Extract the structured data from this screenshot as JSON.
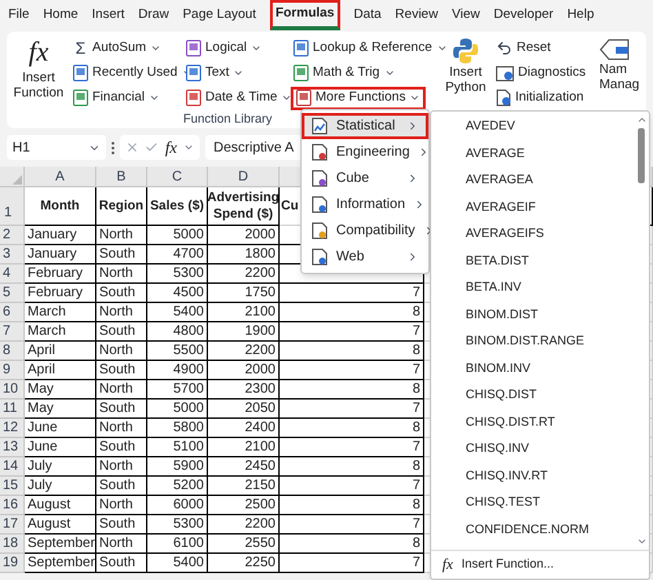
{
  "tabs": [
    {
      "label": "File",
      "selected": false
    },
    {
      "label": "Home",
      "selected": false
    },
    {
      "label": "Insert",
      "selected": false
    },
    {
      "label": "Draw",
      "selected": false
    },
    {
      "label": "Page Layout",
      "selected": false
    },
    {
      "label": "Formulas",
      "selected": true
    },
    {
      "label": "Data",
      "selected": false
    },
    {
      "label": "Review",
      "selected": false
    },
    {
      "label": "View",
      "selected": false
    },
    {
      "label": "Developer",
      "selected": false
    },
    {
      "label": "Help",
      "selected": false
    }
  ],
  "function_library": {
    "insert_function": {
      "icon": "fx",
      "label": "Insert Function"
    },
    "group_label": "Function Library",
    "buttons": [
      {
        "kind": "sum",
        "icon": "Σ",
        "label": "AutoSum",
        "open": false
      },
      {
        "kind": "book",
        "color": "#2f6fd1",
        "label": "Recently Used",
        "open": false
      },
      {
        "kind": "book",
        "color": "#2e9a4c",
        "label": "Financial",
        "open": false
      },
      {
        "kind": "book",
        "color": "#8a4fc7",
        "label": "Logical",
        "open": false
      },
      {
        "kind": "book",
        "color": "#2f6fd1",
        "label": "Text",
        "open": false
      },
      {
        "kind": "book",
        "color": "#d23a3a",
        "label": "Date & Time",
        "open": false
      },
      {
        "kind": "book",
        "color": "#2f6fd1",
        "label": "Lookup & Reference",
        "open": false
      },
      {
        "kind": "book",
        "color": "#2e9a4c",
        "label": "Math & Trig",
        "open": false
      },
      {
        "kind": "book",
        "color": "#c23a3a",
        "label": "More Functions",
        "open": true
      }
    ]
  },
  "python": {
    "insert_python": [
      "Insert",
      "Python"
    ],
    "buttons": [
      {
        "kind": "reset",
        "label": "Reset"
      },
      {
        "kind": "diagnostics",
        "label": "Diagnostics"
      },
      {
        "kind": "initialization",
        "label": "Initialization"
      }
    ]
  },
  "name_manager": [
    "Nam",
    "Manag"
  ],
  "formula_bar": {
    "name_box": "H1",
    "fx": "fx",
    "formula": "Descriptive A"
  },
  "sheet": {
    "columns": [
      "A",
      "B",
      "C",
      "D"
    ],
    "header_row": {
      "number": "1",
      "cells": [
        "Month",
        "Region",
        "Sales ($)",
        "Advertising Spend ($)",
        "Cu"
      ]
    },
    "rows": [
      {
        "number": "2",
        "cells": [
          "January",
          "North",
          "5000",
          "2000"
        ]
      },
      {
        "number": "3",
        "cells": [
          "January",
          "South",
          "4700",
          "1800"
        ]
      },
      {
        "number": "4",
        "cells": [
          "February",
          "North",
          "5300",
          "2200"
        ]
      },
      {
        "number": "5",
        "cells": [
          "February",
          "South",
          "4500",
          "1750",
          "7"
        ]
      },
      {
        "number": "6",
        "cells": [
          "March",
          "North",
          "5400",
          "2100",
          "8"
        ]
      },
      {
        "number": "7",
        "cells": [
          "March",
          "South",
          "4800",
          "1900",
          "7"
        ]
      },
      {
        "number": "8",
        "cells": [
          "April",
          "North",
          "5500",
          "2200",
          "8"
        ]
      },
      {
        "number": "9",
        "cells": [
          "April",
          "South",
          "4900",
          "2000",
          "7"
        ]
      },
      {
        "number": "10",
        "cells": [
          "May",
          "North",
          "5700",
          "2300",
          "8"
        ]
      },
      {
        "number": "11",
        "cells": [
          "May",
          "South",
          "5000",
          "2050",
          "7"
        ]
      },
      {
        "number": "12",
        "cells": [
          "June",
          "North",
          "5800",
          "2400",
          "8"
        ]
      },
      {
        "number": "13",
        "cells": [
          "June",
          "South",
          "5100",
          "2100",
          "7"
        ]
      },
      {
        "number": "14",
        "cells": [
          "July",
          "North",
          "5900",
          "2450",
          "8"
        ]
      },
      {
        "number": "15",
        "cells": [
          "July",
          "South",
          "5200",
          "2150",
          "7"
        ]
      },
      {
        "number": "16",
        "cells": [
          "August",
          "North",
          "6000",
          "2500",
          "8"
        ]
      },
      {
        "number": "17",
        "cells": [
          "August",
          "South",
          "5300",
          "2200",
          "7"
        ]
      },
      {
        "number": "18",
        "cells": [
          "September",
          "North",
          "6100",
          "2550",
          "8"
        ]
      },
      {
        "number": "19",
        "cells": [
          "September",
          "South",
          "5400",
          "2250",
          "7"
        ]
      }
    ]
  },
  "more_functions_menu": {
    "items": [
      {
        "kind": "statistical",
        "label": "Statistical",
        "selected": true
      },
      {
        "kind": "engineering",
        "label": "Engineering",
        "selected": false
      },
      {
        "kind": "cube",
        "label": "Cube",
        "selected": false
      },
      {
        "kind": "information",
        "label": "Information",
        "selected": false
      },
      {
        "kind": "compatibility",
        "label": "Compatibility",
        "selected": false
      },
      {
        "kind": "web",
        "label": "Web",
        "selected": false
      }
    ]
  },
  "statistical_menu": {
    "functions": [
      "AVEDEV",
      "AVERAGE",
      "AVERAGEA",
      "AVERAGEIF",
      "AVERAGEIFS",
      "BETA.DIST",
      "BETA.INV",
      "BINOM.DIST",
      "BINOM.DIST.RANGE",
      "BINOM.INV",
      "CHISQ.DIST",
      "CHISQ.DIST.RT",
      "CHISQ.INV",
      "CHISQ.INV.RT",
      "CHISQ.TEST",
      "CONFIDENCE.NORM"
    ],
    "footer": {
      "icon": "fx",
      "label": "Insert Function..."
    }
  }
}
